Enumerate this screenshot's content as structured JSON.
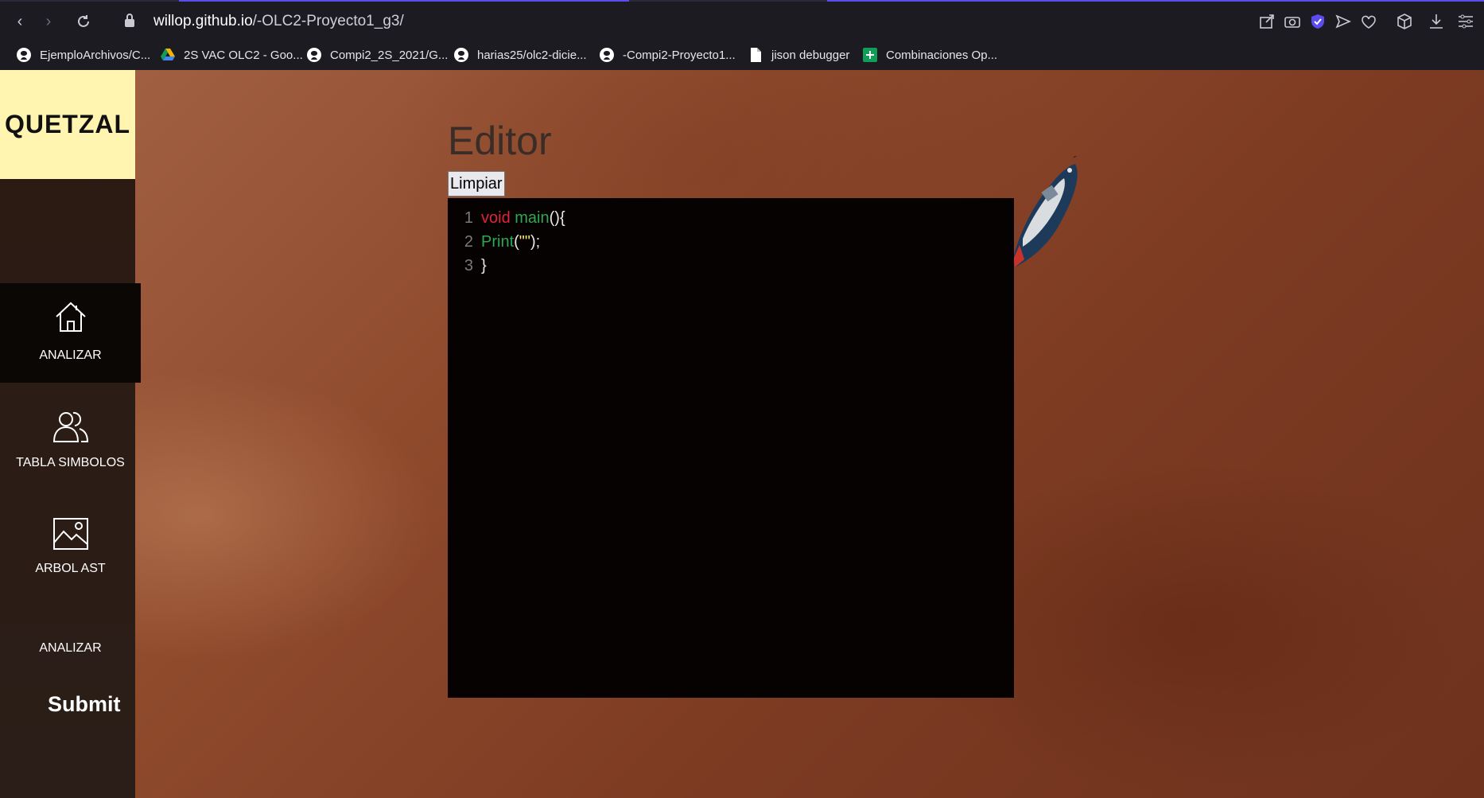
{
  "browser": {
    "url_domain": "willop.github.io",
    "url_path": "/-OLC2-Proyecto1_g3/",
    "bookmarks": [
      {
        "label": "EjemploArchivos/C...",
        "icon": "github-icon"
      },
      {
        "label": "2S VAC OLC2 - Goo...",
        "icon": "google-drive-icon"
      },
      {
        "label": "Compi2_2S_2021/G...",
        "icon": "github-icon"
      },
      {
        "label": "harias25/olc2-dicie...",
        "icon": "github-icon"
      },
      {
        "label": "-Compi2-Proyecto1...",
        "icon": "github-icon"
      },
      {
        "label": "jison debugger",
        "icon": "document-icon"
      },
      {
        "label": "Combinaciones Op...",
        "icon": "google-sheets-icon"
      }
    ]
  },
  "sidebar": {
    "logo": "QUETZAL",
    "items": [
      {
        "label": "ANALIZAR",
        "icon": "home-icon",
        "active": true
      },
      {
        "label": "TABLA SIMBOLOS",
        "icon": "users-icon",
        "active": false
      },
      {
        "label": "ARBOL AST",
        "icon": "image-icon",
        "active": false
      },
      {
        "label": "ANALIZAR",
        "icon": "",
        "active": false
      }
    ],
    "submit": "Submit"
  },
  "main": {
    "title": "Editor",
    "clear_button": "Limpiar",
    "code_lines": [
      {
        "num": "1",
        "tokens": [
          {
            "t": "void",
            "c": "kw"
          },
          {
            "t": " ",
            "c": "pl"
          },
          {
            "t": "main",
            "c": "fn"
          },
          {
            "t": "(){",
            "c": "pl"
          }
        ]
      },
      {
        "num": "2",
        "tokens": [
          {
            "t": "Print",
            "c": "fn"
          },
          {
            "t": "(",
            "c": "pl"
          },
          {
            "t": "\"\"",
            "c": "st"
          },
          {
            "t": ");",
            "c": "pl"
          }
        ]
      },
      {
        "num": "3",
        "tokens": [
          {
            "t": "}",
            "c": "pl"
          }
        ]
      }
    ]
  },
  "colors": {
    "accent": "#5b4cf0",
    "logo_bg": "#fff4b0",
    "keyword": "#e0243a",
    "function": "#2fa84f",
    "string": "#f5e86a"
  }
}
